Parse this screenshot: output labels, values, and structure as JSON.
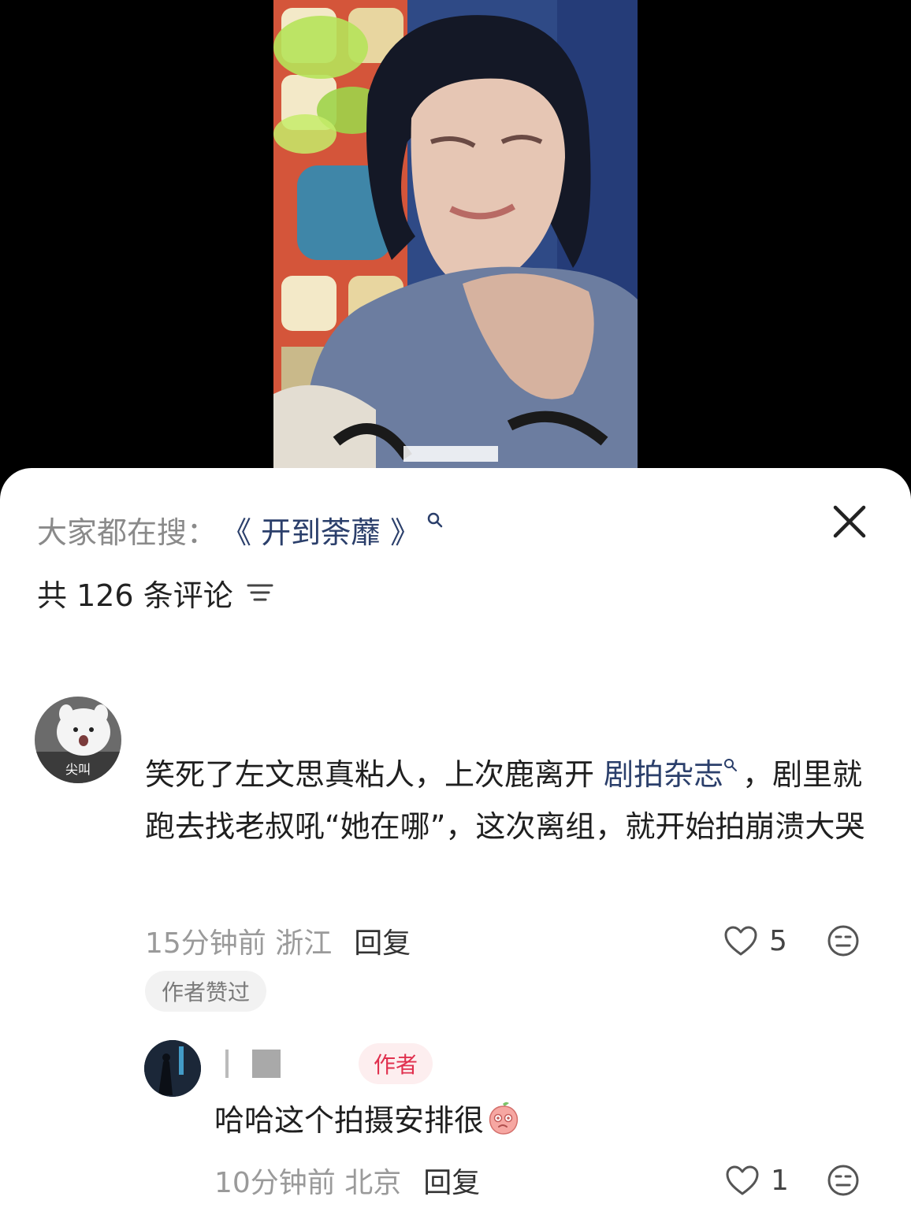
{
  "trending": {
    "label": "大家都在搜：",
    "query": "《 开到荼蘼 》"
  },
  "comments_header": {
    "count_text": "共 126 条评论"
  },
  "comment": {
    "text_part1": "笑死了左文思真粘人，上次鹿离开 ",
    "link_text": "剧拍杂志",
    "text_part2": "，剧里就跑去找老叔吼“她在哪”，这次离组，就开始拍崩溃大哭",
    "avatar_caption": "尖叫",
    "time_location": "15分钟前 浙江",
    "reply_label": "回复",
    "likes": "5",
    "author_liked": "作者赞过"
  },
  "reply": {
    "author_tag": "作者",
    "text": "哈哈这个拍摄安排很",
    "time_location": "10分钟前 北京",
    "reply_label": "回复",
    "likes": "1"
  },
  "colors": {
    "link": "#2b3f6b",
    "author_tag": "#e0304e",
    "muted": "#9a9a9a"
  },
  "icons": [
    "search-icon",
    "close-icon",
    "sort-icon",
    "heart-icon",
    "dislike-face-icon",
    "peach-emoji-icon"
  ]
}
